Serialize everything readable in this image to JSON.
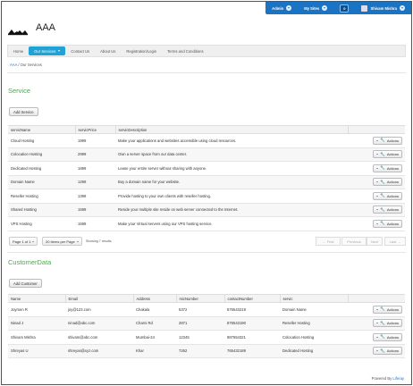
{
  "dock": {
    "admin_label": "Admin",
    "sites_label": "My Sites",
    "notifications_count": "0",
    "user_name": "Shivam Mishra"
  },
  "site": {
    "title": "AAA"
  },
  "nav": {
    "tabs": [
      {
        "label": "Home"
      },
      {
        "label": "Our Services"
      },
      {
        "label": "Contact Us"
      },
      {
        "label": "About Us"
      },
      {
        "label": "Registration/Login"
      },
      {
        "label": "Terms and Conditions"
      }
    ]
  },
  "breadcrumb": {
    "root": "AAA",
    "separator": "/",
    "current": "Our Services"
  },
  "service": {
    "heading": "Service",
    "add_button": "Add Service",
    "columns": [
      "servicName",
      "servicPrice",
      "servicDescription"
    ],
    "actions_label": "Actions",
    "rows": [
      {
        "name": "Cloud Hosting",
        "price": "1999",
        "desc": "Make your applications and websites accessible using cloud resources."
      },
      {
        "name": "Colocation Hosting",
        "price": "2999",
        "desc": "Own a server space from our data center."
      },
      {
        "name": "Dedicated Hosting",
        "price": "1899",
        "desc": "Lease your entire server without sharing with anyone."
      },
      {
        "name": "Domain Name",
        "price": "1299",
        "desc": "Buy a domain name for your website."
      },
      {
        "name": "Reseller Hosting",
        "price": "1399",
        "desc": "Provide hosting to your own clients with reseller hosting."
      },
      {
        "name": "Shared Hosting",
        "price": "1599",
        "desc": "Reside your multiple site reside on web server connected to the Internet."
      },
      {
        "name": "VPS Hosting",
        "price": "1599",
        "desc": "Make your Virtual servers using our VPS hosting service."
      }
    ]
  },
  "pagination": {
    "page_label": "Page 1 of 1",
    "per_page_label": "20 Items per Page",
    "showing": "Showing 7 results.",
    "first": "← First",
    "previous": "Previous",
    "next": "Next",
    "last": "Last →"
  },
  "customer": {
    "heading": "CustomerData",
    "add_button": "Add Customer",
    "columns": [
      "Name",
      "Email",
      "Address",
      "micNumber",
      "contactNumber",
      "servic"
    ],
    "actions_label": "Actions",
    "rows": [
      {
        "name": "Joymen R",
        "email": "joy@123.com",
        "address": "Chakala",
        "mic": "5372",
        "contact": "876543219",
        "servic": "Domain Name"
      },
      {
        "name": "Ninad J",
        "email": "ninad@abc.com",
        "address": "Charni Rd",
        "mic": "2871",
        "contact": "876543190",
        "servic": "Reseller Hosting"
      },
      {
        "name": "Shivam Mishra",
        "email": "shivam@abc.com",
        "address": "Mumbai-24",
        "mic": "12345",
        "contact": "987654321",
        "servic": "Colocation Hosting"
      },
      {
        "name": "Shreyas U",
        "email": "shreyas@xyz.com",
        "address": "Khar",
        "mic": "7262",
        "contact": "765432189",
        "servic": "Dedicated Hosting"
      }
    ]
  },
  "footer": {
    "powered_by": "Powered By",
    "brand": "Liferay"
  },
  "colors": {
    "dock": "#1b73c4",
    "active_tab": "#1fa2d6",
    "heading": "#3eb23e"
  }
}
